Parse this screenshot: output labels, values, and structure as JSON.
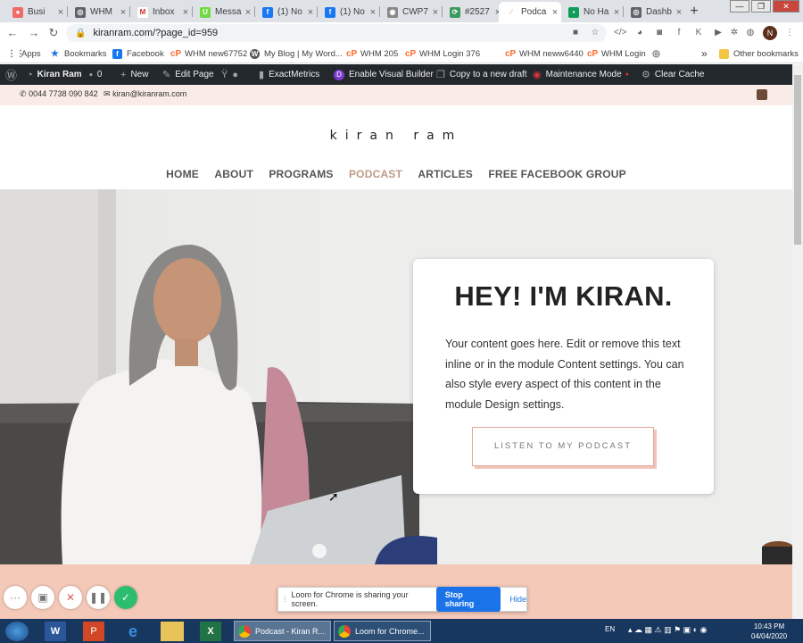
{
  "tabs": [
    {
      "title": "Busi",
      "favicon": "asana-icon",
      "color": "#f06a6a"
    },
    {
      "title": "WHM",
      "favicon": "globe-icon",
      "color": "#5f6368"
    },
    {
      "title": "Inbox",
      "favicon": "gmail-icon",
      "color": "#d93025"
    },
    {
      "title": "Messa",
      "favicon": "upwork-icon",
      "color": "#6fda44"
    },
    {
      "title": "(1) No",
      "favicon": "facebook-icon",
      "color": "#1877f2"
    },
    {
      "title": "(1) No",
      "favicon": "facebook-icon",
      "color": "#1877f2"
    },
    {
      "title": "CWP7",
      "favicon": "cwp-icon",
      "color": "#888888"
    },
    {
      "title": "#2527",
      "favicon": "ticket-icon",
      "color": "#3c9a5f"
    },
    {
      "title": "Podca",
      "favicon": "podcast-icon",
      "color": "#e8b4a6"
    },
    {
      "title": "No Ha",
      "favicon": "chat-icon",
      "color": "#0f9d58"
    },
    {
      "title": "Dashb",
      "favicon": "globe-icon",
      "color": "#5f6368"
    }
  ],
  "toolbar": {
    "url": "kiranram.com/?page_id=959",
    "profile_initial": "N"
  },
  "bookmarks": [
    {
      "label": "Apps",
      "icon": "apps-grid-icon"
    },
    {
      "label": "Bookmarks",
      "icon": "star-icon"
    },
    {
      "label": "Facebook",
      "icon": "facebook-icon"
    },
    {
      "label": "WHM new67752",
      "icon": "cpanel-icon"
    },
    {
      "label": "My Blog | My Word...",
      "icon": "wordpress-icon"
    },
    {
      "label": "WHM 205",
      "icon": "cpanel-icon"
    },
    {
      "label": "WHM Login 376",
      "icon": "cpanel-icon"
    },
    {
      "label": "WHM neww6440",
      "icon": "cpanel-icon"
    },
    {
      "label": "WHM Login",
      "icon": "cpanel-icon"
    },
    {
      "label": "Other bookmarks",
      "icon": "folder-icon"
    }
  ],
  "bookmarks_more": "»",
  "wpbar": {
    "site": "Kiran Ram",
    "comments": "0",
    "new": "New",
    "edit": "Edit Page",
    "exactmetrics": "ExactMetrics",
    "visual_builder": "Enable Visual Builder",
    "copy_draft": "Copy to a new draft",
    "maintenance": "Maintenance Mode",
    "clear_cache": "Clear Cache"
  },
  "topinfo": {
    "phone": "0044 7738 090 842",
    "email": "kiran@kiranram.com"
  },
  "site": {
    "logo": "kiran ram",
    "nav": [
      "HOME",
      "ABOUT",
      "PROGRAMS",
      "PODCAST",
      "ARTICLES",
      "FREE FACEBOOK GROUP"
    ],
    "active_nav": "PODCAST"
  },
  "hero": {
    "heading": "HEY! I'M KIRAN.",
    "body": "Your content goes here. Edit or remove this text inline or in the module Content settings. You can also style every aspect of this content in the module Design settings.",
    "cta": "LISTEN TO MY PODCAST"
  },
  "loom": {
    "message": "Loom for Chrome is sharing your screen.",
    "stop": "Stop sharing",
    "hide": "Hide"
  },
  "taskbar": {
    "apps": [
      "Podcast - Kiran R...",
      "Loom for Chrome..."
    ],
    "lang": "EN",
    "time": "10:43 PM",
    "date": "04/04/2020"
  }
}
